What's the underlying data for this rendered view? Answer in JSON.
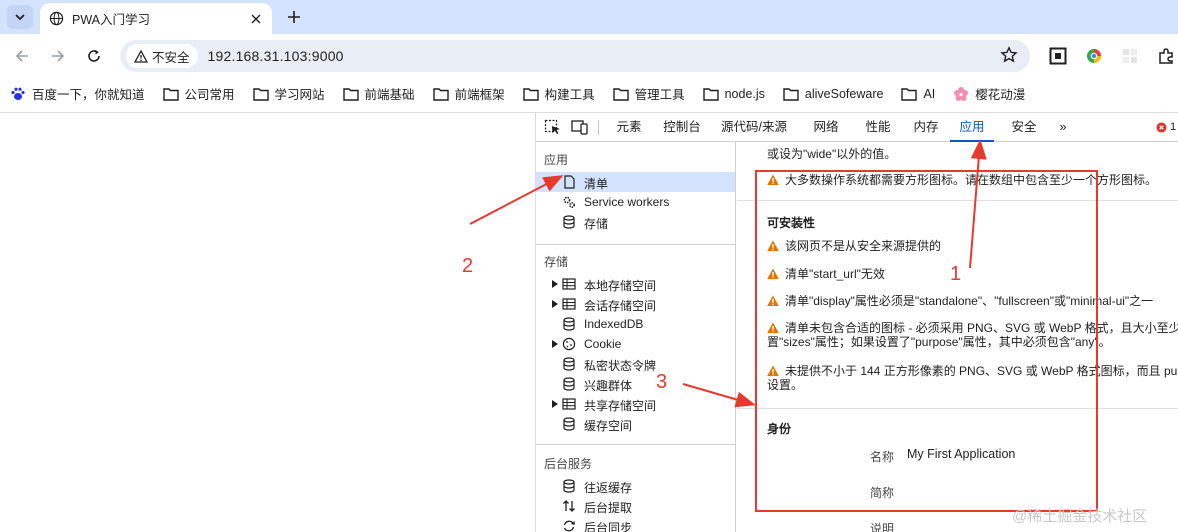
{
  "browser": {
    "tab_title": "PWA入门学习",
    "security_label": "不安全",
    "url": "192.168.31.103:9000"
  },
  "bookmarks": [
    {
      "label": "百度一下，你就知道",
      "icon": "baidu-paw-icon"
    },
    {
      "label": "公司常用",
      "icon": "folder-icon"
    },
    {
      "label": "学习网站",
      "icon": "folder-icon"
    },
    {
      "label": "前端基础",
      "icon": "folder-icon"
    },
    {
      "label": "前端框架",
      "icon": "folder-icon"
    },
    {
      "label": "构建工具",
      "icon": "folder-icon"
    },
    {
      "label": "管理工具",
      "icon": "folder-icon"
    },
    {
      "label": "node.js",
      "icon": "folder-icon"
    },
    {
      "label": "aliveSofeware",
      "icon": "folder-icon"
    },
    {
      "label": "AI",
      "icon": "folder-icon"
    },
    {
      "label": "樱花动漫",
      "icon": "sakura-icon"
    }
  ],
  "devtools": {
    "tabs": [
      "元素",
      "控制台",
      "源代码/来源",
      "网络",
      "性能",
      "内存",
      "应用",
      "安全"
    ],
    "active_tab": "应用",
    "more_tabs": "»",
    "error_count": "1",
    "sidebar": {
      "app_section": "应用",
      "app_items": [
        "清单",
        "Service workers",
        "存储"
      ],
      "storage_section": "存储",
      "storage_items": [
        "本地存储空间",
        "会话存储空间",
        "IndexedDB",
        "Cookie",
        "私密状态令牌",
        "兴趣群体",
        "共享存储空间",
        "缓存空间"
      ],
      "background_section": "后台服务",
      "background_items": [
        "往返缓存",
        "后台提取",
        "后台同步"
      ]
    },
    "main": {
      "top_line": "或设为\"wide\"以外的值。",
      "icon_warning": "大多数操作系统都需要方形图标。请在数组中包含至少一个方形图标。",
      "installability_heading": "可安装性",
      "installability_warnings": [
        [
          "该网页不是从安全来源提供的"
        ],
        [
          "清单\"start_url\"无效"
        ],
        [
          "清单\"display\"属性必须是\"standalone\"、\"fullscreen\"或\"minimal-ui\"之一"
        ],
        [
          "清单未包含合适的图标 - 必须采用 PNG、SVG 或 WebP 格式，且大小至少",
          "置\"sizes\"属性；如果设置了\"purpose\"属性，其中必须包含\"any\"。"
        ],
        [
          "未提供不小于 144 正方形像素的 PNG、SVG 或 WebP 格式图标，而且 pu",
          "设置。"
        ]
      ],
      "identity_heading": "身份",
      "identity": {
        "name_key": "名称",
        "name_value": "My First Application",
        "short_name_key": "简称",
        "description_key": "说明"
      }
    }
  },
  "annotations": {
    "label_1": "1",
    "label_2": "2",
    "label_3": "3",
    "color": "#e8392f"
  },
  "watermark": "@稀土掘金技术社区"
}
